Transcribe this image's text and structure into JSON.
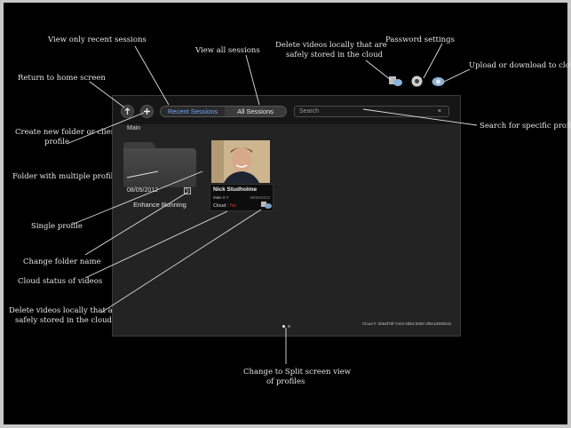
{
  "annotations": {
    "view_recent": "View only recent sessions",
    "view_all": "View all sessions",
    "delete_top": [
      "Delete videos locally that are",
      "safely stored in the  cloud"
    ],
    "password": "Password settings",
    "upload": "Upload or download to cloud",
    "return_home": "Return to home screen",
    "create_folder": [
      "Create new folder or client",
      "profile"
    ],
    "search_profile": "Search for specific profile",
    "folder_multi": "Folder with multiple profiles",
    "single_profile": "Single profile",
    "change_folder": "Change folder name",
    "cloud_status": "Cloud status of videos",
    "delete_bottom": [
      "Delete videos locally that are",
      "safely stored in the  cloud"
    ],
    "split_screen": [
      "Change to Split screen view",
      "of profiles"
    ]
  },
  "app": {
    "tabs": {
      "recent": "Recent Sessions",
      "all": "All Sessions"
    },
    "search": {
      "placeholder": "Search",
      "clear": "×"
    },
    "breadcrumb": "Main",
    "folder": {
      "date": "08/05/2012",
      "name": "Enhance Running"
    },
    "profile": {
      "name": "Nick Studholme",
      "meta": "Male 0 Y",
      "date": "08/05/2012",
      "cloud_label": "Cloud :",
      "cloud_status": "No"
    },
    "cloud_id": "Cloud #: 6b8af78f-74c9-4d84-b992-2f8e1d3b6b1b",
    "pages": {
      "current": 1,
      "total": 2
    }
  },
  "colors": {
    "tab_active": "#6aa8ff",
    "cloud_status_no": "#e03030",
    "background": "#000000"
  }
}
